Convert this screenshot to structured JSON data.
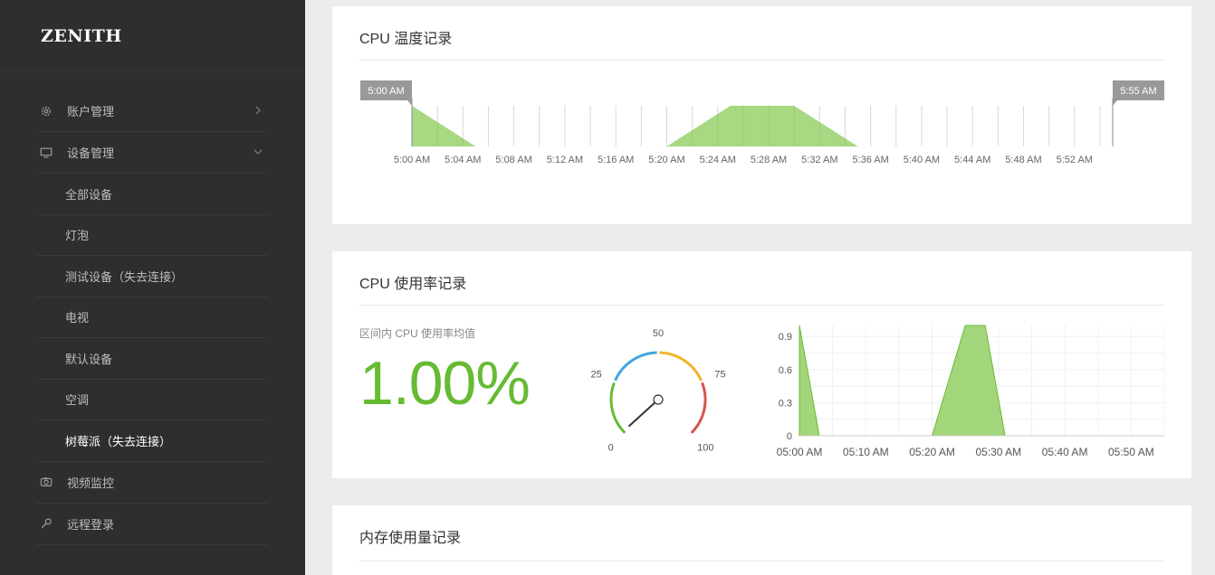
{
  "brand": "ZENITH",
  "sidebar": {
    "items": [
      {
        "label": "账户管理",
        "icon": "gear-icon"
      },
      {
        "label": "设备管理",
        "icon": "monitor-icon"
      }
    ],
    "sub_items": [
      {
        "label": "全部设备"
      },
      {
        "label": "灯泡"
      },
      {
        "label": "测试设备（失去连接）"
      },
      {
        "label": "电视"
      },
      {
        "label": "默认设备"
      },
      {
        "label": "空调"
      },
      {
        "label": "树莓派（失去连接）",
        "active": true
      }
    ],
    "bottom_items": [
      {
        "label": "视频监控",
        "icon": "camera-icon"
      },
      {
        "label": "远程登录",
        "icon": "wrench-icon"
      }
    ]
  },
  "temperature_card": {
    "title": "CPU 温度记录",
    "range_start_label": "5:00 AM",
    "range_end_label": "5:55 AM"
  },
  "usage_card": {
    "title": "CPU 使用率记录",
    "avg_label": "区间内 CPU 使用率均值",
    "avg_value": "1.00%"
  },
  "memory_card": {
    "title": "内存使用量记录"
  },
  "colors": {
    "accent_green": "#66bb33",
    "area_fill": "#a3d67a",
    "gauge_blue": "#3fa7e0",
    "gauge_yellow": "#f0b429",
    "gauge_red": "#d9534f"
  },
  "chart_data": [
    {
      "type": "area",
      "name": "temperature",
      "x": [
        "5:00 AM",
        "5:04 AM",
        "5:08 AM",
        "5:12 AM",
        "5:16 AM",
        "5:20 AM",
        "5:24 AM",
        "5:28 AM",
        "5:32 AM",
        "5:36 AM",
        "5:40 AM",
        "5:44 AM",
        "5:48 AM",
        "5:52 AM"
      ],
      "tick_labels": [
        "5:00 AM",
        "5:04 AM",
        "5:08 AM",
        "5:12 AM",
        "5:16 AM",
        "5:20 AM",
        "5:24 AM",
        "5:28 AM",
        "5:32 AM",
        "5:36 AM",
        "5:40 AM",
        "5:44 AM",
        "5:48 AM",
        "5:52 AM"
      ],
      "points": [
        [
          0,
          1
        ],
        [
          5,
          0
        ],
        [
          20,
          0
        ],
        [
          25,
          1
        ],
        [
          30,
          1
        ],
        [
          35,
          0
        ],
        [
          55,
          0
        ]
      ],
      "xlim": [
        0,
        55
      ]
    },
    {
      "type": "gauge",
      "name": "cpu-usage-gauge",
      "value": 1,
      "min": 0,
      "max": 100,
      "tick_labels": [
        "0",
        "25",
        "50",
        "75",
        "100"
      ]
    },
    {
      "type": "area",
      "name": "cpu-usage",
      "x_tick_labels": [
        "05:00 AM",
        "05:10 AM",
        "05:20 AM",
        "05:30 AM",
        "05:40 AM",
        "05:50 AM"
      ],
      "y_tick_labels": [
        "0",
        "0.3",
        "0.6",
        "0.9"
      ],
      "ylim": [
        0,
        1
      ],
      "xlim": [
        0,
        55
      ],
      "points": [
        [
          0,
          1
        ],
        [
          3,
          0
        ],
        [
          20,
          0
        ],
        [
          25,
          1
        ],
        [
          28,
          1
        ],
        [
          31,
          0
        ],
        [
          55,
          0
        ]
      ]
    }
  ]
}
